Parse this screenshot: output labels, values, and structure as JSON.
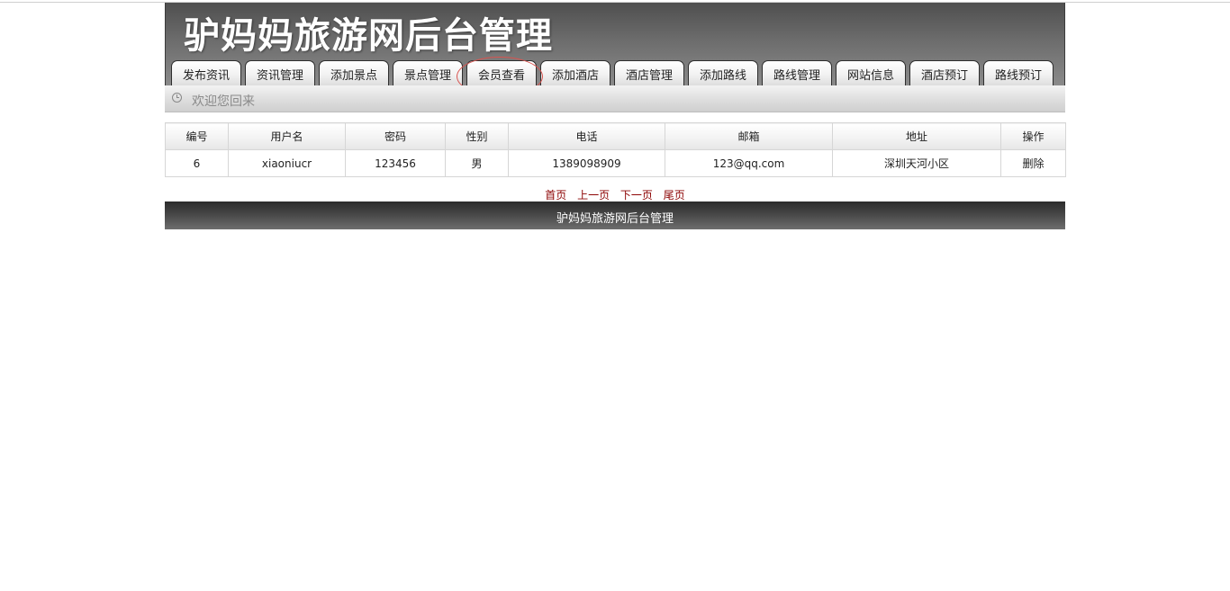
{
  "header": {
    "title": "驴妈妈旅游网后台管理"
  },
  "nav": {
    "tabs": [
      {
        "label": "发布资讯"
      },
      {
        "label": "资讯管理"
      },
      {
        "label": "添加景点"
      },
      {
        "label": "景点管理"
      },
      {
        "label": "会员查看"
      },
      {
        "label": "添加酒店"
      },
      {
        "label": "酒店管理"
      },
      {
        "label": "添加路线"
      },
      {
        "label": "路线管理"
      },
      {
        "label": "网站信息"
      },
      {
        "label": "酒店预订"
      },
      {
        "label": "路线预订"
      }
    ],
    "active_tab": "会员查看"
  },
  "welcome": {
    "text": "欢迎您回来",
    "icon": "clock-icon"
  },
  "table": {
    "headers": [
      "编号",
      "用户名",
      "密码",
      "性别",
      "电话",
      "邮箱",
      "地址",
      "操作"
    ],
    "rows": [
      {
        "id": "6",
        "username": "xiaoniucr",
        "password": "123456",
        "gender": "男",
        "phone": "1389098909",
        "email": "123@qq.com",
        "address": "深圳天河小区",
        "action": "删除"
      }
    ]
  },
  "pager": {
    "first": "首页",
    "prev": "上一页",
    "next": "下一页",
    "last": "尾页"
  },
  "footer": {
    "text": "驴妈妈旅游网后台管理"
  },
  "colors": {
    "header_dark": "#4f4f4f",
    "pager_link": "#8b0000",
    "highlight_ring": "#d9534f"
  }
}
